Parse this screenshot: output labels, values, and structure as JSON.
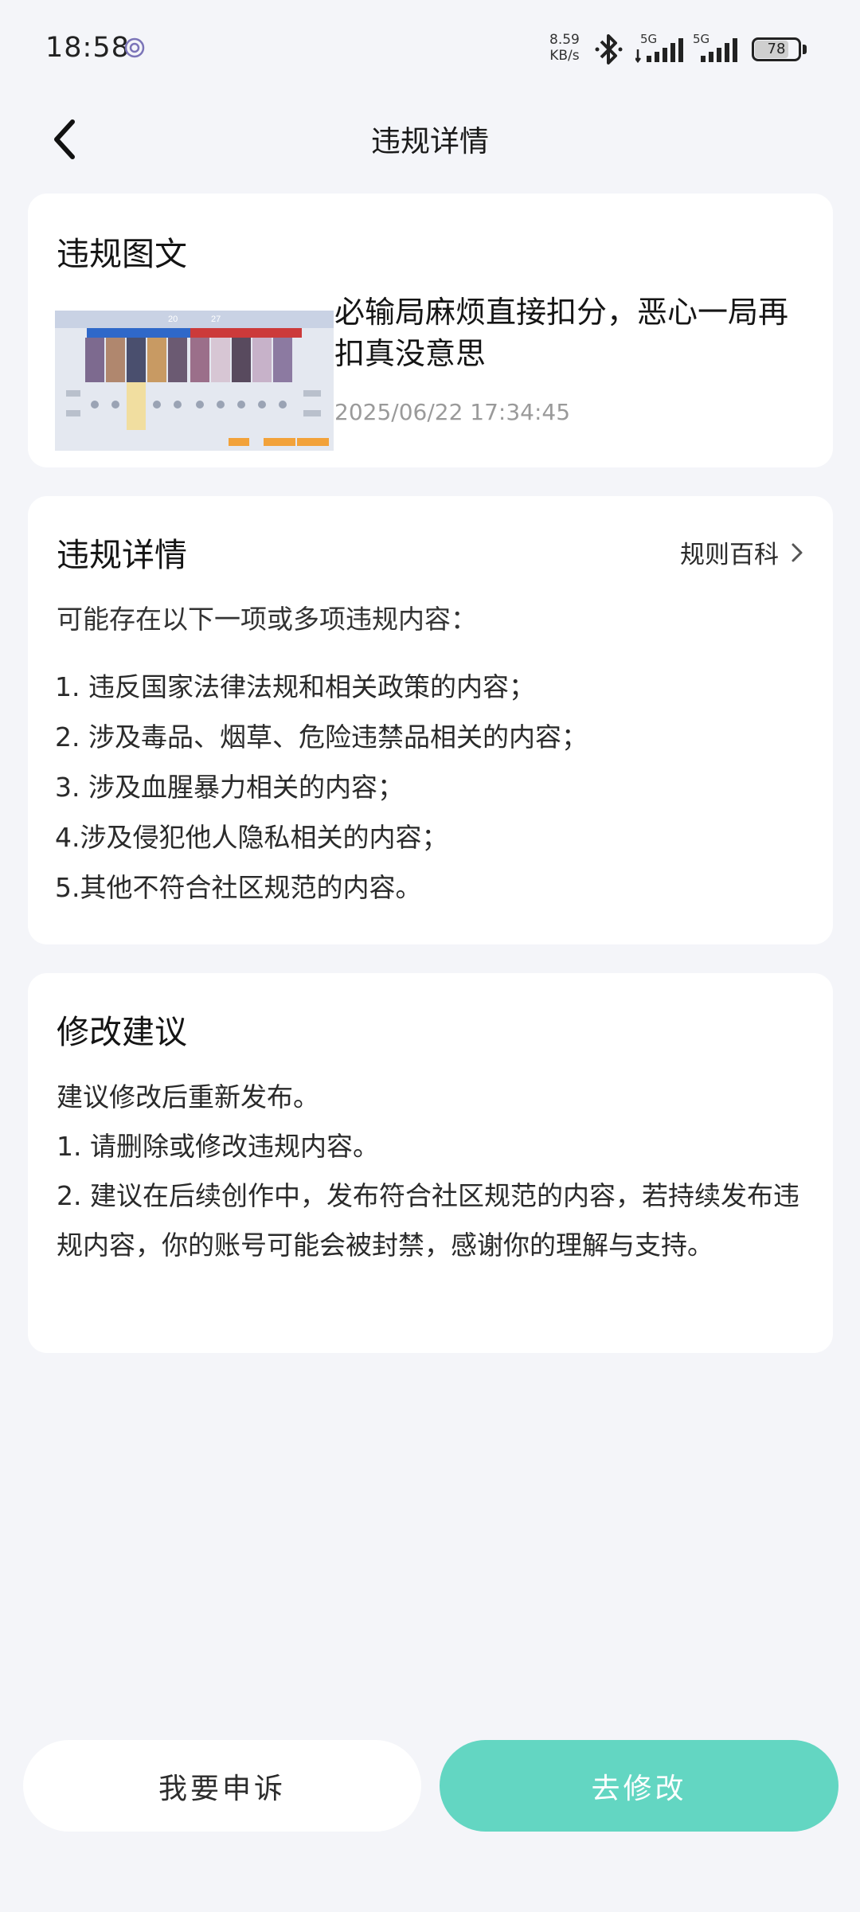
{
  "status_bar": {
    "time": "18:58",
    "net_speed_value": "8.59",
    "net_speed_unit": "KB/s",
    "sim1_tag": "5G",
    "sim2_tag": "5G",
    "battery": "78"
  },
  "header": {
    "title": "违规详情"
  },
  "post_card": {
    "title": "违规图文",
    "post_text": "必输局麻烦直接扣分，恶心一局再扣真没意思",
    "timestamp": "2025/06/22 17:34:45",
    "thumbnail_scores": [
      "20",
      "27"
    ]
  },
  "detail_card": {
    "title": "违规详情",
    "rules_link_label": "规则百科",
    "intro": "可能存在以下一项或多项违规内容：",
    "items": [
      "1. 违反国家法律法规和相关政策的内容；",
      "2. 涉及毒品、烟草、危险违禁品相关的内容；",
      "3. 涉及血腥暴力相关的内容；",
      "4.涉及侵犯他人隐私相关的内容；",
      "5.其他不符合社区规范的内容。"
    ]
  },
  "advice_card": {
    "title": "修改建议",
    "lines": [
      "建议修改后重新发布。",
      "1. 请删除或修改违规内容。",
      "2. 建议在后续创作中，发布符合社区规范的内容，若持续发布违规内容，你的账号可能会被封禁，感谢你的理解与支持。"
    ]
  },
  "actions": {
    "appeal_label": "我要申诉",
    "edit_label": "去修改"
  },
  "colors": {
    "background": "#f4f5f9",
    "card": "#ffffff",
    "accent": "#63d6c2"
  }
}
